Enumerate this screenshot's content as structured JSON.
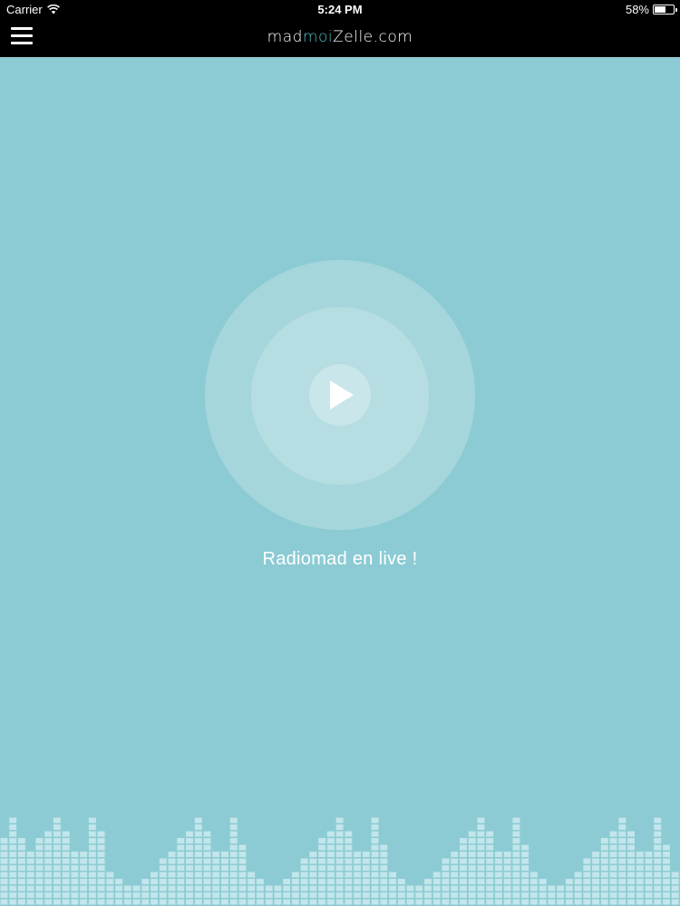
{
  "status_bar": {
    "carrier": "Carrier",
    "time": "5:24 PM",
    "battery_text": "58%",
    "battery_level": 0.58
  },
  "nav": {
    "logo_pre": "mad",
    "logo_accent": "moi",
    "logo_post": "Zelle.com"
  },
  "player": {
    "caption": "Radiomad en live !"
  },
  "equalizer": {
    "levels": [
      10,
      13,
      10,
      8,
      10,
      11,
      13,
      11,
      8,
      8,
      13,
      11,
      5,
      4,
      3,
      3,
      4,
      5,
      7,
      8,
      10,
      11,
      13,
      11,
      8,
      8,
      13,
      9,
      5,
      4,
      3,
      3,
      4,
      5,
      7,
      8,
      10,
      11,
      13,
      11,
      8,
      8,
      13,
      9,
      5,
      4,
      3,
      3,
      4,
      5,
      7,
      8,
      10,
      11,
      13,
      11,
      8,
      8,
      13,
      9,
      5,
      4,
      3,
      3,
      4,
      5,
      7,
      8,
      10,
      11,
      13,
      11,
      8,
      8,
      13,
      9,
      5
    ],
    "colors": {
      "background": "#8ccbd3",
      "bar": "#c2e6eb"
    }
  }
}
